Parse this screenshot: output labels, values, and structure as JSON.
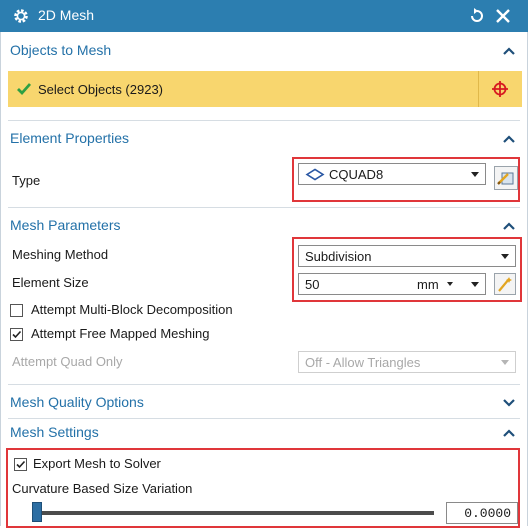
{
  "window": {
    "title": "2D Mesh"
  },
  "objects_to_mesh": {
    "header": "Objects to Mesh",
    "select_label": "Select Objects (2923)"
  },
  "element_properties": {
    "header": "Element Properties",
    "type_label": "Type",
    "type_value": "CQUAD8"
  },
  "mesh_parameters": {
    "header": "Mesh Parameters",
    "meshing_method_label": "Meshing Method",
    "meshing_method_value": "Subdivision",
    "element_size_label": "Element Size",
    "element_size_value": "50",
    "element_size_unit": "mm",
    "multi_block_label": "Attempt Multi-Block Decomposition",
    "multi_block_checked": false,
    "free_mapped_label": "Attempt Free Mapped Meshing",
    "free_mapped_checked": true,
    "quad_only_label": "Attempt Quad Only",
    "quad_only_value": "Off - Allow Triangles"
  },
  "mesh_quality_options": {
    "header": "Mesh Quality Options"
  },
  "mesh_settings": {
    "header": "Mesh Settings",
    "export_label": "Export Mesh to Solver",
    "export_checked": true,
    "curvature_label": "Curvature Based Size Variation",
    "curvature_value": "0.0000",
    "curvature_fraction": 0.0
  },
  "colors": {
    "title_bar": "#2c7eb0",
    "section_header": "#2371a8",
    "selection_bar": "#f8d66e",
    "highlight": "#e0363a"
  },
  "icons": [
    "gear-icon",
    "reset-icon",
    "close-icon",
    "chevron-up-icon",
    "chevron-down-icon",
    "checkmark-icon",
    "crosshair-icon",
    "cquad8-icon",
    "element-type-icon",
    "magic-wand-icon"
  ]
}
